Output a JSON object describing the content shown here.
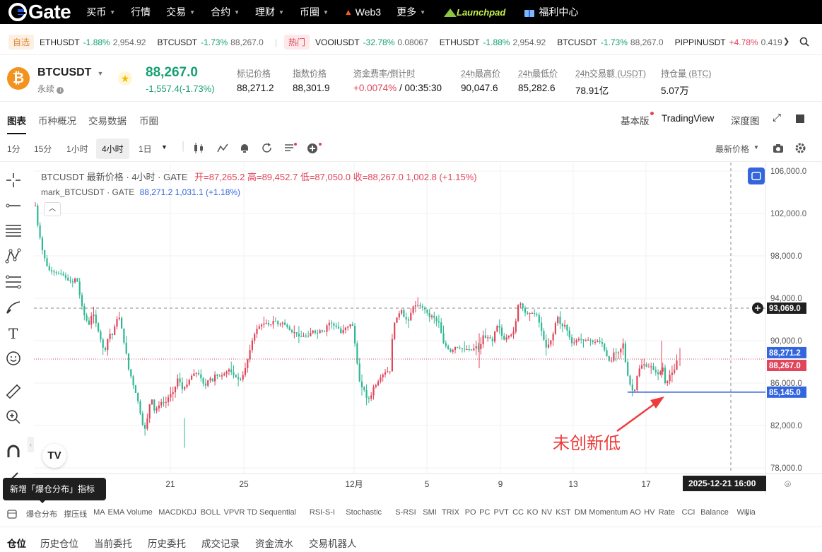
{
  "nav": {
    "logo": "Gate",
    "items": [
      {
        "label": "买币",
        "caret": true
      },
      {
        "label": "行情",
        "caret": false
      },
      {
        "label": "交易",
        "caret": true
      },
      {
        "label": "合约",
        "caret": true
      },
      {
        "label": "理财",
        "caret": true
      },
      {
        "label": "币圈",
        "caret": true
      },
      {
        "label": "Web3",
        "caret": false
      },
      {
        "label": "更多",
        "caret": true
      }
    ],
    "launchpad": "Launchpad",
    "welfare": "福利中心"
  },
  "ticker": {
    "fav_tag": "自选",
    "hot_tag": "热门",
    "fav": [
      {
        "sym": "ETHUSDT",
        "chg": "-1.88%",
        "price": "2,954.92"
      },
      {
        "sym": "BTCUSDT",
        "chg": "-1.73%",
        "price": "88,267.0"
      }
    ],
    "hot": [
      {
        "sym": "VOOIUSDT",
        "chg": "-32.78%",
        "price": "0.08067"
      },
      {
        "sym": "ETHUSDT",
        "chg": "-1.88%",
        "price": "2,954.92"
      },
      {
        "sym": "BTCUSDT",
        "chg": "-1.73%",
        "price": "88,267.0"
      },
      {
        "sym": "PIPPINUSDT",
        "chg": "+4.78%",
        "price": "0.419"
      }
    ]
  },
  "header": {
    "symbol": "BTCUSDT",
    "type": "永续",
    "price": "88,267.0",
    "change": "-1,557.4(-1.73%)",
    "stats": [
      {
        "label": "标记价格",
        "value": "88,271.2"
      },
      {
        "label": "指数价格",
        "value": "88,301.9"
      },
      {
        "label": "资金费率/倒计时",
        "value": "+0.0074% / 00:35:30"
      },
      {
        "label": "24h最高价",
        "value": "90,047.6"
      },
      {
        "label": "24h最低价",
        "value": "85,282.6"
      },
      {
        "label": "24h交易额 (USDT)",
        "value": "78.91亿"
      },
      {
        "label": "持仓量 (BTC)",
        "value": "5.07万"
      }
    ]
  },
  "tabs": {
    "left": [
      "图表",
      "币种概况",
      "交易数据",
      "币圈"
    ],
    "right": [
      "基本版",
      "TradingView",
      "深度图"
    ]
  },
  "toolbar": {
    "intervals": [
      "1分",
      "15分",
      "1小时",
      "4小时",
      "1日"
    ],
    "active": "4小时",
    "price_type": "最新价格"
  },
  "chart_data": {
    "type": "candlestick",
    "legend_line1": "BTCUSDT 最新价格 · 4小时 · GATE",
    "ohlc": {
      "o": "开=87,265.2",
      "h": "高=89,452.7",
      "l": "低=87,050.0",
      "c": "收=88,267.0",
      "chg": "1,002.8 (+1.15%)"
    },
    "legend_line2": "mark_BTCUSDT · GATE",
    "mark": {
      "price": "88,271.2",
      "chg": "1,031.1 (+1.18%)"
    },
    "y_ticks": [
      "106,000.0",
      "102,000.0",
      "98,000.0",
      "94,000.0",
      "90,000.0",
      "86,000.0",
      "82,000.0",
      "78,000.0"
    ],
    "x_ticks": [
      "21",
      "25",
      "12月",
      "5",
      "9",
      "13",
      "17"
    ],
    "ylim": [
      77000,
      107000
    ],
    "crosshair_price": "93,069.0",
    "crosshair_time": "2025-12-21   16:00",
    "mark_label": "88,271.2",
    "last_label": "88,267.0",
    "support_label": "85,145.0",
    "support_value": 85145,
    "annotation": "未创新低",
    "path": [
      [
        0,
        103900
      ],
      [
        5,
        101000
      ],
      [
        12,
        98500
      ],
      [
        20,
        96700
      ],
      [
        30,
        96400
      ],
      [
        40,
        96300
      ],
      [
        48,
        95700
      ],
      [
        55,
        95500
      ],
      [
        60,
        96100
      ],
      [
        66,
        93800
      ],
      [
        72,
        92200
      ],
      [
        78,
        91500
      ],
      [
        83,
        92800
      ],
      [
        88,
        91600
      ],
      [
        94,
        90200
      ],
      [
        100,
        88800
      ],
      [
        106,
        90700
      ],
      [
        112,
        90500
      ],
      [
        116,
        92000
      ],
      [
        122,
        92200
      ],
      [
        126,
        90200
      ],
      [
        130,
        89100
      ],
      [
        134,
        87300
      ],
      [
        138,
        86500
      ],
      [
        142,
        85400
      ],
      [
        146,
        84700
      ],
      [
        150,
        83300
      ],
      [
        154,
        82000
      ],
      [
        158,
        81600
      ],
      [
        162,
        83400
      ],
      [
        166,
        84800
      ],
      [
        170,
        83400
      ],
      [
        175,
        83700
      ],
      [
        180,
        84200
      ],
      [
        186,
        84100
      ],
      [
        192,
        84900
      ],
      [
        198,
        85200
      ],
      [
        204,
        86600
      ],
      [
        210,
        85400
      ],
      [
        216,
        85800
      ],
      [
        222,
        86600
      ],
      [
        228,
        87000
      ],
      [
        234,
        86800
      ],
      [
        240,
        85900
      ],
      [
        244,
        85700
      ],
      [
        248,
        86700
      ],
      [
        252,
        86000
      ],
      [
        256,
        86800
      ],
      [
        262,
        86600
      ],
      [
        268,
        86800
      ],
      [
        276,
        87300
      ],
      [
        282,
        86800
      ],
      [
        288,
        86400
      ],
      [
        292,
        86300
      ],
      [
        296,
        86800
      ],
      [
        300,
        87600
      ],
      [
        304,
        88700
      ],
      [
        310,
        90300
      ],
      [
        316,
        91200
      ],
      [
        322,
        91500
      ],
      [
        328,
        91700
      ],
      [
        334,
        91400
      ],
      [
        340,
        92000
      ],
      [
        346,
        91500
      ],
      [
        352,
        91700
      ],
      [
        358,
        91300
      ],
      [
        364,
        90800
      ],
      [
        370,
        90800
      ],
      [
        376,
        90300
      ],
      [
        382,
        90500
      ],
      [
        388,
        90400
      ],
      [
        394,
        91000
      ],
      [
        400,
        90600
      ],
      [
        406,
        91100
      ],
      [
        410,
        90600
      ],
      [
        414,
        91400
      ],
      [
        418,
        91700
      ],
      [
        422,
        91600
      ],
      [
        426,
        91300
      ],
      [
        430,
        91300
      ],
      [
        434,
        90700
      ],
      [
        440,
        91200
      ],
      [
        446,
        91400
      ],
      [
        450,
        91800
      ],
      [
        454,
        89800
      ],
      [
        458,
        87500
      ],
      [
        462,
        85500
      ],
      [
        466,
        85700
      ],
      [
        470,
        84600
      ],
      [
        476,
        84500
      ],
      [
        480,
        85600
      ],
      [
        484,
        85800
      ],
      [
        490,
        86500
      ],
      [
        496,
        87000
      ],
      [
        500,
        87100
      ],
      [
        504,
        87100
      ],
      [
        508,
        91300
      ],
      [
        512,
        92000
      ],
      [
        516,
        92500
      ],
      [
        520,
        92900
      ],
      [
        524,
        92100
      ],
      [
        530,
        91900
      ],
      [
        536,
        93200
      ],
      [
        542,
        93400
      ],
      [
        548,
        93200
      ],
      [
        554,
        92900
      ],
      [
        560,
        92200
      ],
      [
        564,
        92400
      ],
      [
        570,
        91800
      ],
      [
        574,
        91700
      ],
      [
        578,
        89900
      ],
      [
        584,
        89400
      ],
      [
        590,
        88900
      ],
      [
        596,
        89400
      ],
      [
        602,
        89300
      ],
      [
        608,
        89200
      ],
      [
        614,
        89200
      ],
      [
        620,
        89100
      ],
      [
        626,
        89500
      ],
      [
        630,
        89100
      ],
      [
        636,
        90600
      ],
      [
        640,
        90100
      ],
      [
        644,
        90500
      ],
      [
        648,
        89700
      ],
      [
        654,
        91400
      ],
      [
        658,
        91400
      ],
      [
        664,
        90000
      ],
      [
        670,
        90400
      ],
      [
        676,
        90600
      ],
      [
        680,
        91000
      ],
      [
        686,
        93800
      ],
      [
        690,
        93300
      ],
      [
        696,
        92500
      ],
      [
        702,
        92600
      ],
      [
        706,
        92600
      ],
      [
        712,
        92400
      ],
      [
        716,
        91400
      ],
      [
        720,
        90500
      ],
      [
        724,
        89300
      ],
      [
        730,
        89800
      ],
      [
        736,
        90900
      ],
      [
        740,
        92500
      ],
      [
        746,
        91300
      ],
      [
        752,
        91500
      ],
      [
        756,
        90600
      ],
      [
        762,
        89600
      ],
      [
        766,
        90000
      ],
      [
        772,
        90200
      ],
      [
        778,
        90000
      ],
      [
        786,
        90100
      ],
      [
        792,
        89800
      ],
      [
        798,
        90000
      ],
      [
        804,
        89700
      ],
      [
        810,
        88600
      ],
      [
        816,
        87800
      ],
      [
        820,
        88900
      ],
      [
        826,
        88800
      ],
      [
        830,
        89200
      ],
      [
        834,
        89800
      ],
      [
        838,
        87300
      ],
      [
        842,
        86200
      ],
      [
        846,
        85300
      ],
      [
        850,
        85300
      ],
      [
        854,
        86900
      ],
      [
        858,
        87600
      ],
      [
        864,
        87800
      ],
      [
        868,
        87400
      ],
      [
        872,
        87700
      ],
      [
        878,
        87100
      ],
      [
        884,
        86800
      ],
      [
        890,
        87500
      ],
      [
        894,
        85500
      ],
      [
        898,
        86700
      ],
      [
        902,
        86900
      ],
      [
        906,
        87200
      ],
      [
        910,
        88267
      ]
    ]
  },
  "left_tools": [
    "crosshair",
    "trend-line",
    "horizontal-lines",
    "pattern",
    "fib",
    "brush",
    "text",
    "emoji",
    "ruler",
    "zoom",
    "magnet",
    "pencil"
  ],
  "tooltip": "新增「爆仓分布」指标",
  "indicators": [
    "爆仓分布",
    "撑压线",
    "MA",
    "EMA",
    "Volume",
    "MACD",
    "KDJ",
    "BOLL",
    "VPVR",
    "TD Sequential",
    "RSI-S-I",
    "Stochastic",
    "S-RSI",
    "SMI",
    "TRIX",
    "PO",
    "PC",
    "PVT",
    "CC",
    "KO",
    "NV",
    "KST",
    "DM",
    "Momentum",
    "AO",
    "HV",
    "Rate",
    "CCI",
    "Balance",
    "Willia"
  ],
  "bottom_tabs": [
    "仓位",
    "历史仓位",
    "当前委托",
    "历史委托",
    "成交记录",
    "资金流水",
    "交易机器人"
  ],
  "colors": {
    "up": "#e0455b",
    "down": "#2eb893",
    "accent": "#3366dd"
  }
}
